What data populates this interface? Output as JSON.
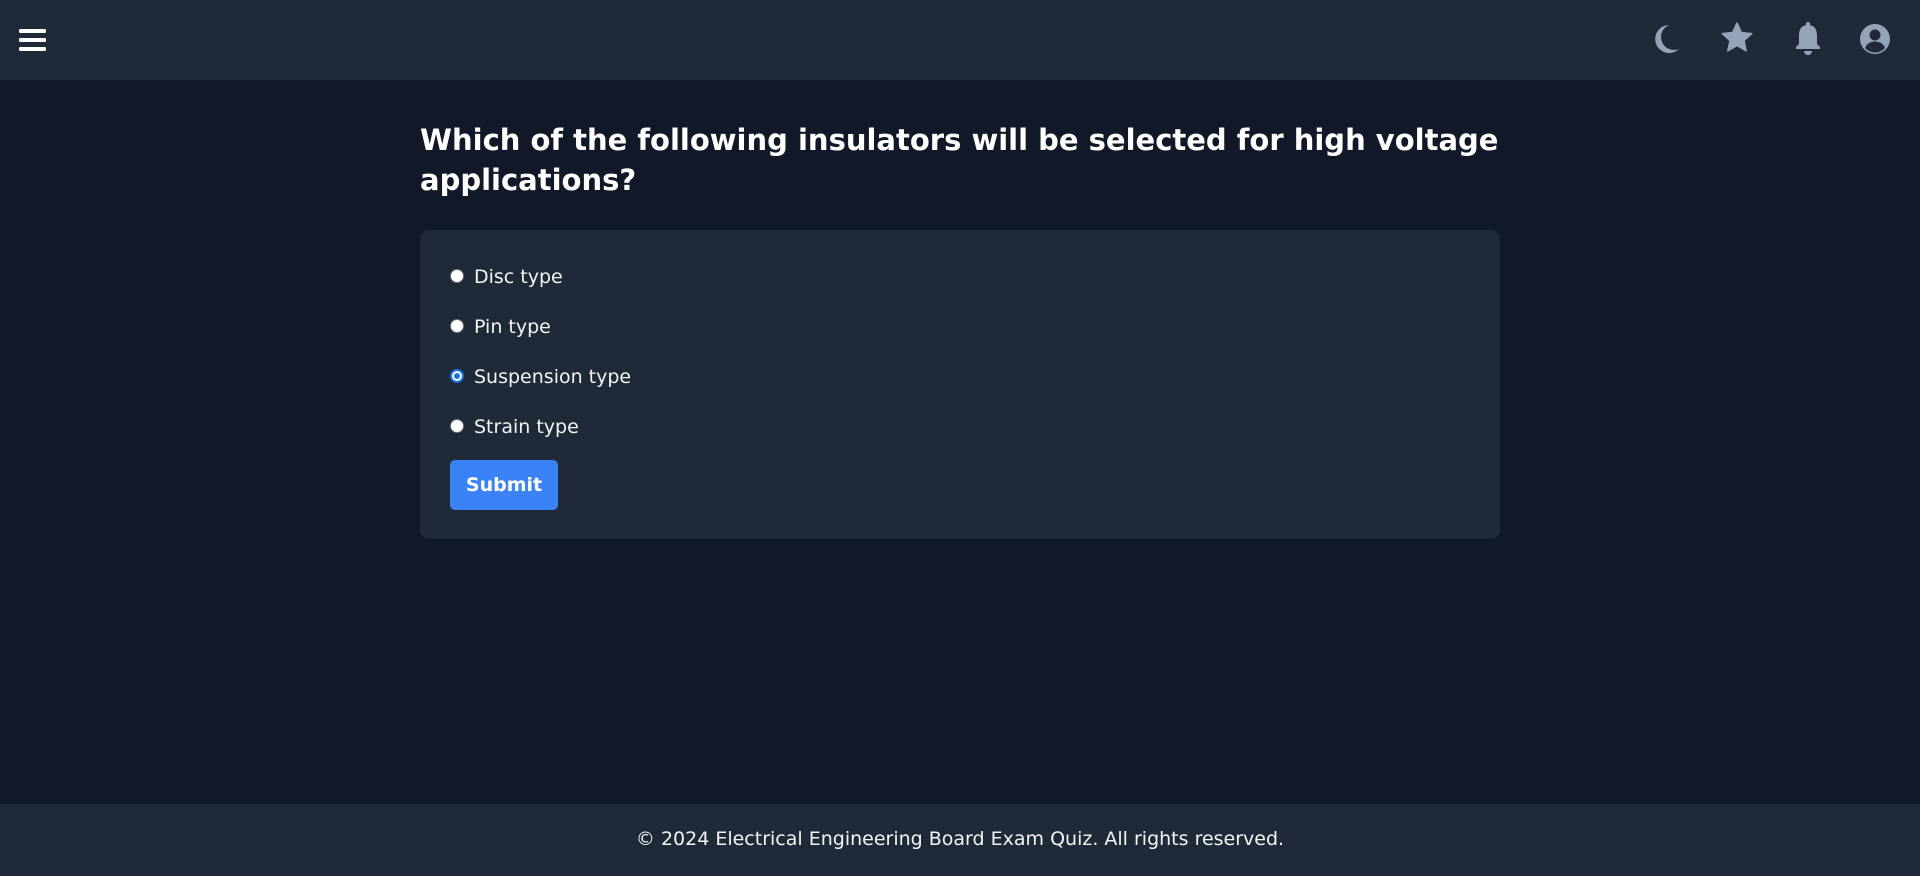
{
  "colors": {
    "background": "#111827",
    "surface": "#1f2937",
    "accent": "#3b82f6",
    "icon": "#94a3b8",
    "text": "#ffffff"
  },
  "header": {
    "menu_icon": "hamburger-menu-icon",
    "icons": [
      "moon-icon",
      "star-icon",
      "bell-icon",
      "user-circle-icon"
    ]
  },
  "quiz": {
    "question": "Which of the following insulators will be selected for high voltage applications?",
    "options": [
      {
        "label": "Disc type",
        "selected": false
      },
      {
        "label": "Pin type",
        "selected": false
      },
      {
        "label": "Suspension type",
        "selected": true
      },
      {
        "label": "Strain type",
        "selected": false
      }
    ],
    "submit_label": "Submit"
  },
  "footer": {
    "text": "© 2024 Electrical Engineering Board Exam Quiz. All rights reserved."
  }
}
